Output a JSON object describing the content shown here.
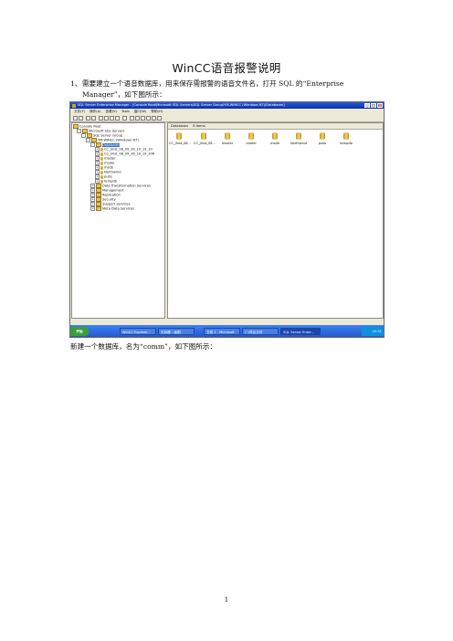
{
  "document": {
    "title": "WinCC语音报警说明",
    "para1_num": "1、",
    "para1_text": "需要建立一个语音数据库，用来保存需报警的语音文件名，打开 SQL 的“Enterprise Manager”，如下图所示：",
    "para2_text": "新建一个数据库，名为“comm”，如下图所示：",
    "page_number": "1"
  },
  "screenshot": {
    "window_title": "SQL Server Enterprise Manager - [Console Root\\Microsoft SQL Servers\\SQL Server Group\\YM-WINCC (Windows NT)\\Databases]",
    "menu": [
      "文件(F)",
      "操作(A)",
      "查看(V)",
      "Tools",
      "窗口(W)",
      "帮助(H)"
    ],
    "tree": {
      "root": "Console Root",
      "servers": "Microsoft SQL Servers",
      "group": "SQL Server Group",
      "server": "YM-WINCC (Windows NT)",
      "databases": "Databases",
      "db_items": [
        "CC_jmst_08_09_26_10_19_10",
        "CC_jmst_08_09_26_10_19_10R",
        "master",
        "model",
        "msdb",
        "Northwind",
        "pubs",
        "tempdb"
      ],
      "other_items": [
        "Data Transformation Services",
        "Management",
        "Replication",
        "Security",
        "Support Services",
        "Meta Data Services"
      ]
    },
    "content_header": {
      "label": "Databases",
      "count": "8 Items"
    },
    "content_items": [
      "CC_jmst_08...",
      "CC_jmst_08...",
      "master",
      "model",
      "msdb",
      "Northwind",
      "pubs",
      "tempdb"
    ],
    "taskbar": {
      "start": "开始",
      "tasks": [
        "WinCC Explorer -",
        "无标题 - 画图",
        "文档 1 - Microsoft",
        "C:\\项目文件",
        "SQL Server Enter..."
      ],
      "clock": "20:31"
    }
  }
}
